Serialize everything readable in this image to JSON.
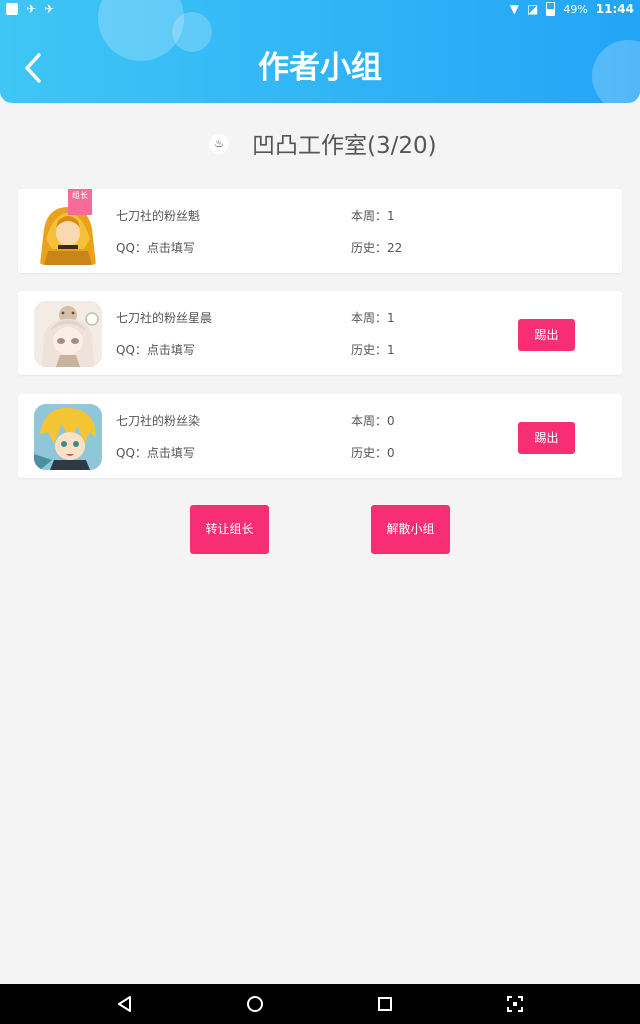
{
  "status_bar": {
    "battery": "49%",
    "time": "11:44"
  },
  "header": {
    "title": "作者小组"
  },
  "group": {
    "icon_glyph": "♨",
    "name": "凹凸工作室(3/20)"
  },
  "members": [
    {
      "name": "七刀社的粉丝魁",
      "qq": "QQ：点击填写",
      "week": "本周：1",
      "history": "历史：22",
      "kick_label": null,
      "badge": "组长"
    },
    {
      "name": "七刀社的粉丝星晨",
      "qq": "QQ：点击填写",
      "week": "本周：1",
      "history": "历史：1",
      "kick_label": "踢出"
    },
    {
      "name": "七刀社的粉丝染",
      "qq": "QQ：点击填写",
      "week": "本周：0",
      "history": "历史：0",
      "kick_label": "踢出"
    }
  ],
  "actions": {
    "transfer_label": "转让组长",
    "dissolve_label": "解散小组"
  },
  "colors": {
    "accent": "#f72e74",
    "header": "#2fb2f6",
    "background": "#f4f4f4"
  },
  "nav_icons": [
    "back-icon",
    "home-icon",
    "recents-icon",
    "screenshot-icon"
  ]
}
